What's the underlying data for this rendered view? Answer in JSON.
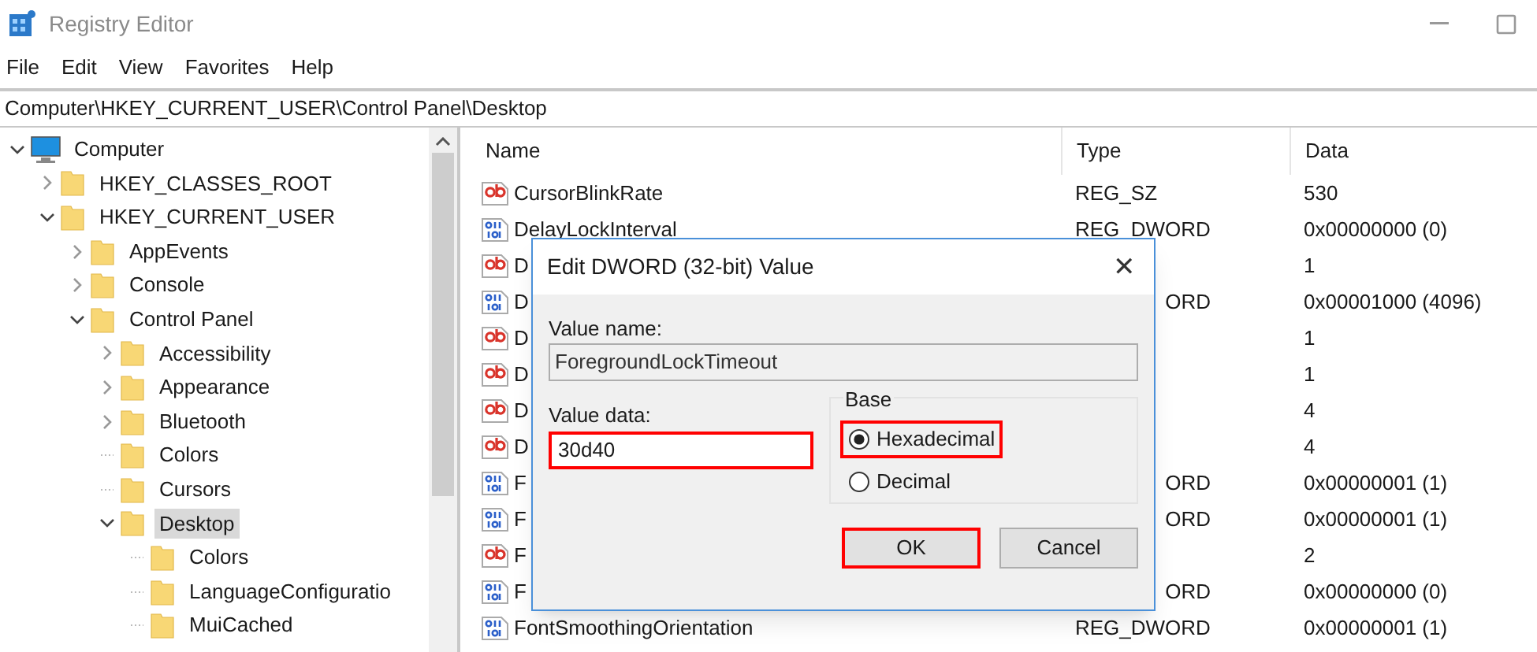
{
  "window": {
    "title": "Registry Editor"
  },
  "menu": [
    "File",
    "Edit",
    "View",
    "Favorites",
    "Help"
  ],
  "address": "Computer\\HKEY_CURRENT_USER\\Control Panel\\Desktop",
  "tree": [
    {
      "label": "Computer",
      "kind": "computer",
      "has_children": true,
      "expanded": true,
      "selected": false,
      "children": [
        {
          "label": "HKEY_CLASSES_ROOT",
          "has_children": true,
          "expanded": false,
          "selected": false
        },
        {
          "label": "HKEY_CURRENT_USER",
          "has_children": true,
          "expanded": true,
          "selected": false,
          "children": [
            {
              "label": "AppEvents",
              "has_children": true,
              "expanded": false,
              "selected": false
            },
            {
              "label": "Console",
              "has_children": true,
              "expanded": false,
              "selected": false
            },
            {
              "label": "Control Panel",
              "has_children": true,
              "expanded": true,
              "selected": false,
              "children": [
                {
                  "label": "Accessibility",
                  "has_children": true,
                  "expanded": false,
                  "selected": false
                },
                {
                  "label": "Appearance",
                  "has_children": true,
                  "expanded": false,
                  "selected": false
                },
                {
                  "label": "Bluetooth",
                  "has_children": true,
                  "expanded": false,
                  "selected": false
                },
                {
                  "label": "Colors",
                  "has_children": false,
                  "selected": false
                },
                {
                  "label": "Cursors",
                  "has_children": false,
                  "selected": false
                },
                {
                  "label": "Desktop",
                  "has_children": true,
                  "expanded": true,
                  "selected": true,
                  "children": [
                    {
                      "label": "Colors",
                      "has_children": false,
                      "selected": false
                    },
                    {
                      "label": "LanguageConfiguratio",
                      "has_children": false,
                      "selected": false
                    },
                    {
                      "label": "MuiCached",
                      "has_children": false,
                      "selected": false
                    }
                  ]
                }
              ]
            }
          ]
        }
      ]
    }
  ],
  "table": {
    "columns": [
      "Name",
      "Type",
      "Data"
    ],
    "rows": [
      {
        "kind": "string",
        "name": "CursorBlinkRate",
        "type": "REG_SZ",
        "data": "530",
        "partly_hidden": false
      },
      {
        "kind": "binary",
        "name": "DelayLockInterval",
        "type": "REG_DWORD",
        "data": "0x00000000 (0)",
        "partly_hidden": false
      },
      {
        "kind": "string",
        "name": "D",
        "data": "1"
      },
      {
        "kind": "binary",
        "name": "D",
        "type": "ORD",
        "data": "0x00001000 (4096)",
        "partly_hidden": true
      },
      {
        "kind": "string",
        "name": "D",
        "data": "1"
      },
      {
        "kind": "string",
        "name": "D",
        "data": "1"
      },
      {
        "kind": "string",
        "name": "D",
        "data": "4"
      },
      {
        "kind": "string",
        "name": "D",
        "data": "4"
      },
      {
        "kind": "binary",
        "name": "F",
        "type": "ORD",
        "data": "0x00000001 (1)",
        "partly_hidden": true
      },
      {
        "kind": "binary",
        "name": "F",
        "type": "ORD",
        "data": "0x00000001 (1)",
        "partly_hidden": true
      },
      {
        "kind": "string",
        "name": "F",
        "data": "2"
      },
      {
        "kind": "binary",
        "name": "F",
        "type": "ORD",
        "data": "0x00000000 (0)",
        "partly_hidden": true
      },
      {
        "kind": "binary",
        "name": "FontSmoothingOrientation",
        "type": "REG_DWORD",
        "data": "0x00000001 (1)",
        "partly_hidden": false
      }
    ]
  },
  "dialog": {
    "title": "Edit DWORD (32-bit) Value",
    "close": "✕",
    "value_name": {
      "label": "Value name:",
      "value": "ForegroundLockTimeout",
      "disabled": true
    },
    "value_data": {
      "label": "Value data:",
      "value": "30d40",
      "highlighted": true
    },
    "base": {
      "label": "Base",
      "options": [
        {
          "label": "Hexadecimal",
          "selected": true,
          "highlighted": true
        },
        {
          "label": "Decimal",
          "selected": false,
          "highlighted": false
        }
      ]
    },
    "buttons": [
      {
        "label": "OK",
        "highlighted": true
      },
      {
        "label": "Cancel",
        "highlighted": false
      }
    ]
  }
}
